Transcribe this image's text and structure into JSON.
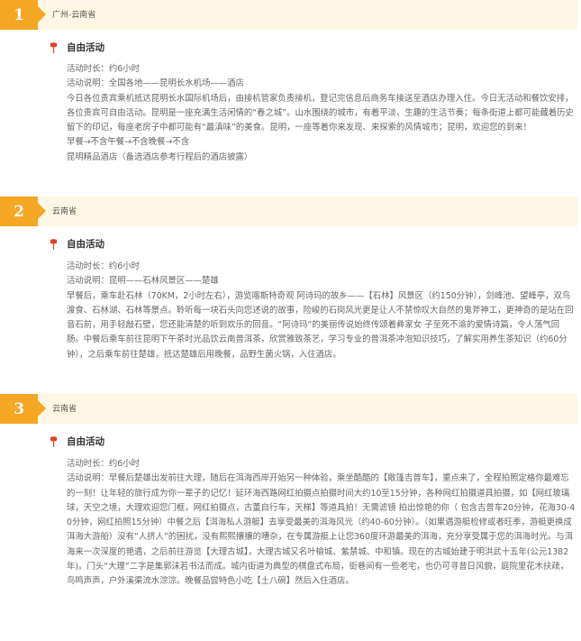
{
  "colors": {
    "accent": "#f5a623",
    "bar_background": "#fdf6e3",
    "pin": "#e0452d"
  },
  "days": [
    {
      "number": "1",
      "place": "广州-云南省",
      "activity_icon": "pin-icon",
      "activity_title": "自由活动",
      "lines": [
        "活动时长：约6小时",
        "活动说明：全国各地——昆明长水机场——酒店",
        "今日各位贵宾乘机抵达昆明长水国际机场后，由接机管家负责接机，登记完信息后商务车接送至酒店办理入住。今日无活动和餐饮安排，各位贵宾可自由活动。昆明是一座充满生活闲情的“春之城”。山水围绕的城市，有着平淡、生趣的生活节奏；每条街道上都可能藏着历史留下的印记，每座老房子中都可能有“最滇味”的美食。昆明，一座等着你来发现、来探索的风情城市；昆明，欢迎您的到来！",
        "早餐→不含午餐→不含晚餐→不含",
        "昆明精品酒店（备选酒店参考行程后的酒店披露）"
      ]
    },
    {
      "number": "2",
      "place": "云南省",
      "activity_icon": "pin-icon",
      "activity_title": "自由活动",
      "lines": [
        "活动时长：约6小时",
        "活动说明：昆明——石林风景区——楚雄",
        "早餐后，乘车赴石林（70KM，2小时左右），游览喀斯特奇观 阿诗玛的故乡——【石林】风景区（约150分钟），剑峰池、望峰亭，双鸟渡食、石林湖、石林等景点。聆听每一块石头向您述说的故事，险峻的石岗风光更是让人不禁惊叹大自然的鬼斧神工，更神奇的是站在回音石前，用手轻敲石壁，您还能清楚的听到欢乐的回音。“阿诗玛”的美丽传说始终传颂着彝家女 子至死不渝的爱情诗篇，令人荡气回肠。中餐后乘车前往昆明下午茶时光品饮云南普洱茶，欣赏雅致茶艺，学习专业的普洱茶冲泡知识技巧，了解实用养生茶知识（约60分钟），之后乘车前往楚雄，抵达楚雄后用晚餐，品野生菌火锅，入住酒店。"
      ]
    },
    {
      "number": "3",
      "place": "云南省",
      "activity_icon": "pin-icon",
      "activity_title": "自由活动",
      "lines": [
        "活动时长：约6小时",
        "活动说明：早餐后楚雄出发前往大理，随后在洱海西岸开始另一种体验，乘坐酷酷的【敞篷吉普车】，重点来了，全程拍照定格你最难忘的一刻！让年轻的旅行成为你一辈子的记忆！延环海西路网红拍摄点拍摄时间大约10至15分钟，各种网红拍摄道具拍摄，如【网红玻璃球，天空之境，大理欢迎您门框，网红拍摄点，古董自行车，天梯】等道具拍！无需滤镜 拍出惊艳的你（ 包含吉普车20分钟，花海30-40分钟，网红拍照15分钟）中餐之后【洱海私人游艇】去享受最美的洱海风光（约40-60分钟）。（如果遇游艇检修或者旺季，游艇更换成洱海大游船）没有“人挤人”的困扰，没有熙熙攘攘的嘈杂，在专属游艇上让您360度环游最美的洱海，充分享受属于您的洱海时光。与洱海来一次深度的艳遇，之后前往游览【大理古城】，大理古城又名叶榆城、紫禁城、中和镇。现在的古城始建于明洪武十五年(公元1382年)。门头“大理”二字是集郭沫若书法而成。城内街道为典型的棋盘式布局，街巷间有一些老宅，也仍可寻昔日风貌，庭院里花木扶疏，鸟鸣声声，户外溪渠流水淙淙。晚餐品尝特色小吃【土八碗】然后入住酒店。"
      ]
    }
  ]
}
